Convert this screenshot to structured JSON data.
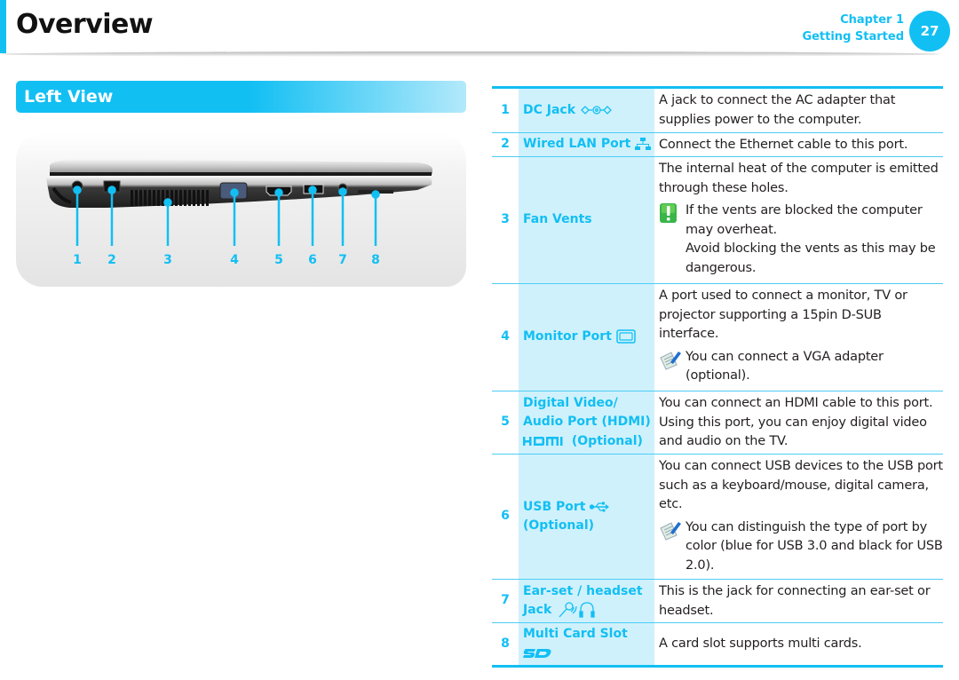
{
  "header": {
    "title": "Overview",
    "chapter": "Chapter 1",
    "chapter_title": "Getting Started",
    "page_number": "27"
  },
  "section": {
    "title": "Left View"
  },
  "figure": {
    "callouts": [
      "1",
      "2",
      "3",
      "4",
      "5",
      "6",
      "7",
      "8"
    ]
  },
  "accent_color": "#12bff3",
  "table": {
    "rows": [
      {
        "num": "1",
        "label": [
          "DC Jack"
        ],
        "icon": "dc-jack-icon",
        "desc": "A jack to connect the AC adapter that supplies power to the computer."
      },
      {
        "num": "2",
        "label": [
          "Wired LAN Port"
        ],
        "icon": "lan-icon",
        "desc": "Connect the Ethernet cable to this port."
      },
      {
        "num": "3",
        "label": [
          "Fan Vents"
        ],
        "desc": "The internal heat of the computer is emitted through these holes.",
        "note_type": "warning-icon",
        "note": "If the vents are blocked the computer may overheat.",
        "note2": "Avoid blocking the vents as this may be dangerous."
      },
      {
        "num": "4",
        "label": [
          "Monitor Port"
        ],
        "icon": "monitor-icon",
        "desc": "A port used to connect a monitor, TV or projector supporting a 15pin D-SUB interface.",
        "note_type": "memo-icon",
        "note": "You can connect a VGA adapter (optional)."
      },
      {
        "num": "5",
        "label": [
          "Digital Video/",
          "Audio Port (HDMI)",
          "(Optional)"
        ],
        "icon": "hdmi-icon",
        "desc": "You can connect an HDMI cable to this port. Using this port, you can enjoy digital video and audio on the TV."
      },
      {
        "num": "6",
        "label": [
          "USB Port",
          "(Optional)"
        ],
        "icon": "usb-icon",
        "desc": "You can connect USB devices to the USB port such as a keyboard/mouse, digital camera, etc.",
        "note_type": "memo-icon",
        "note": "You can distinguish the type of port by color (blue for USB 3.0 and black for USB 2.0)."
      },
      {
        "num": "7",
        "label": [
          "Ear-set / headset",
          "Jack"
        ],
        "icon": "microphone-headphone-icon",
        "desc": "This is the jack for connecting an ear-set or headset."
      },
      {
        "num": "8",
        "label": [
          "Multi Card Slot"
        ],
        "icon": "sd-card-icon",
        "desc": "A card slot supports multi cards."
      }
    ]
  }
}
